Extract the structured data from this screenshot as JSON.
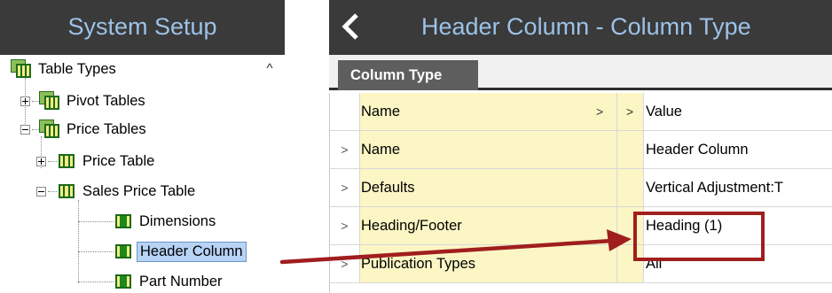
{
  "left_panel": {
    "title": "System Setup",
    "tree": {
      "table_types": "Table Types",
      "pivot_tables": "Pivot Tables",
      "price_tables": "Price Tables",
      "price_table": "Price Table",
      "sales_price_table": "Sales Price Table",
      "dimensions": "Dimensions",
      "header_column": "Header Column",
      "part_number": "Part Number"
    },
    "selected_item": "Header Column",
    "scroll_up_glyph": "^"
  },
  "right_panel": {
    "back_icon": "chevron-left-icon",
    "title": "Header Column - Column Type",
    "tab_label": "Column Type",
    "grid": {
      "header": {
        "name": "Name",
        "sort1": ">",
        "sort2": ">",
        "value": "Value"
      },
      "rows": [
        {
          "indicator": ">",
          "name": "Name",
          "value": "Header Column"
        },
        {
          "indicator": ">",
          "name": "Defaults",
          "value": "Vertical Adjustment:T"
        },
        {
          "indicator": ">",
          "name": "Heading/Footer",
          "value": "Heading (1)"
        },
        {
          "indicator": ">",
          "name": "Publication Types",
          "value": "All"
        }
      ]
    }
  },
  "colors": {
    "header_bg": "#3a3a3a",
    "header_text": "#9cc2e8",
    "selection_bg": "#b7d3f5",
    "name_column_bg": "#fbf6c4",
    "annotation_red": "#a01e1e"
  }
}
